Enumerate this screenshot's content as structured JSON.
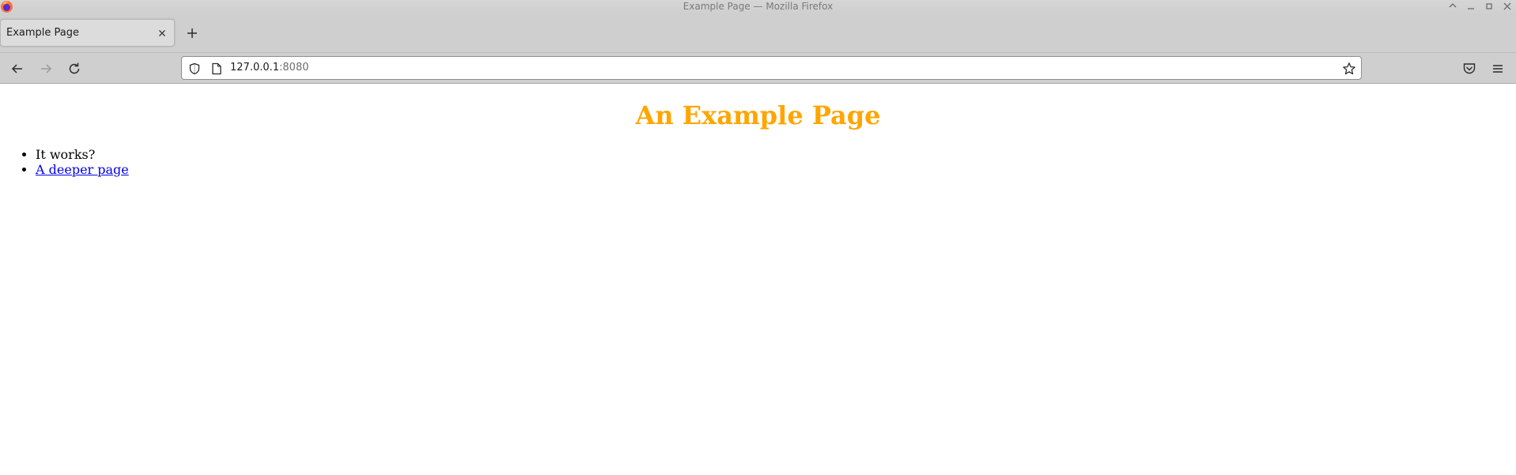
{
  "window": {
    "title": "Example Page — Mozilla Firefox"
  },
  "tabs": [
    {
      "label": "Example Page",
      "active": true
    }
  ],
  "urlbar": {
    "host": "127.0.0.1",
    "port": ":8080"
  },
  "page": {
    "heading": "An Example Page",
    "heading_color": "#ffa500",
    "list": [
      {
        "text": "It works?",
        "is_link": false
      },
      {
        "text": "A deeper page",
        "is_link": true
      }
    ],
    "link_color": "#0000ee"
  },
  "icons": {
    "titlebar": [
      "firefox-logo-icon",
      "minimize-icon",
      "maximize-icon",
      "close-icon"
    ],
    "tabstrip": [
      "tab-close-icon",
      "new-tab-icon"
    ],
    "navbar": [
      "back-icon",
      "forward-icon",
      "reload-icon",
      "shield-icon",
      "page-icon",
      "bookmark-star-icon",
      "pocket-icon",
      "menu-icon"
    ]
  }
}
